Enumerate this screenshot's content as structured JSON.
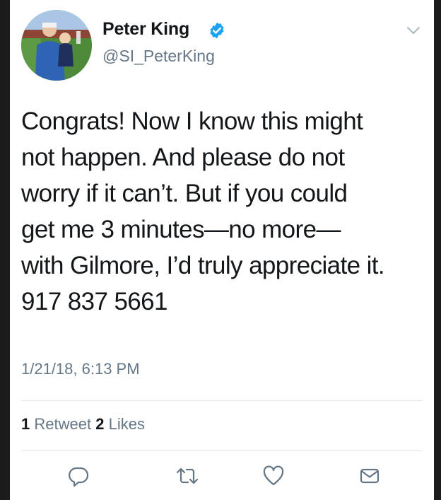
{
  "tweet": {
    "display_name": "Peter King",
    "handle": "@SI_PeterKing",
    "text": "Congrats! Now I know this might\nnot happen. And please do not\nworry if it can’t. But if you could\nget me 3 minutes—no more—\nwith Gilmore, I’d truly appreciate it.\n917 837 5661",
    "timestamp": "1/21/18, 6:13 PM",
    "retweet_count": "1",
    "retweet_label": "Retweet",
    "like_count": "2",
    "like_label": "Likes"
  },
  "icons": {
    "verified": "verified-badge-icon",
    "menu": "chevron-down-icon",
    "reply": "reply-icon",
    "retweet": "retweet-icon",
    "like": "heart-icon",
    "dm": "envelope-icon"
  },
  "colors": {
    "verified": "#1da1f2",
    "secondary_text": "#657786",
    "icon_gray": "#657786",
    "primary_text": "#14171a"
  }
}
